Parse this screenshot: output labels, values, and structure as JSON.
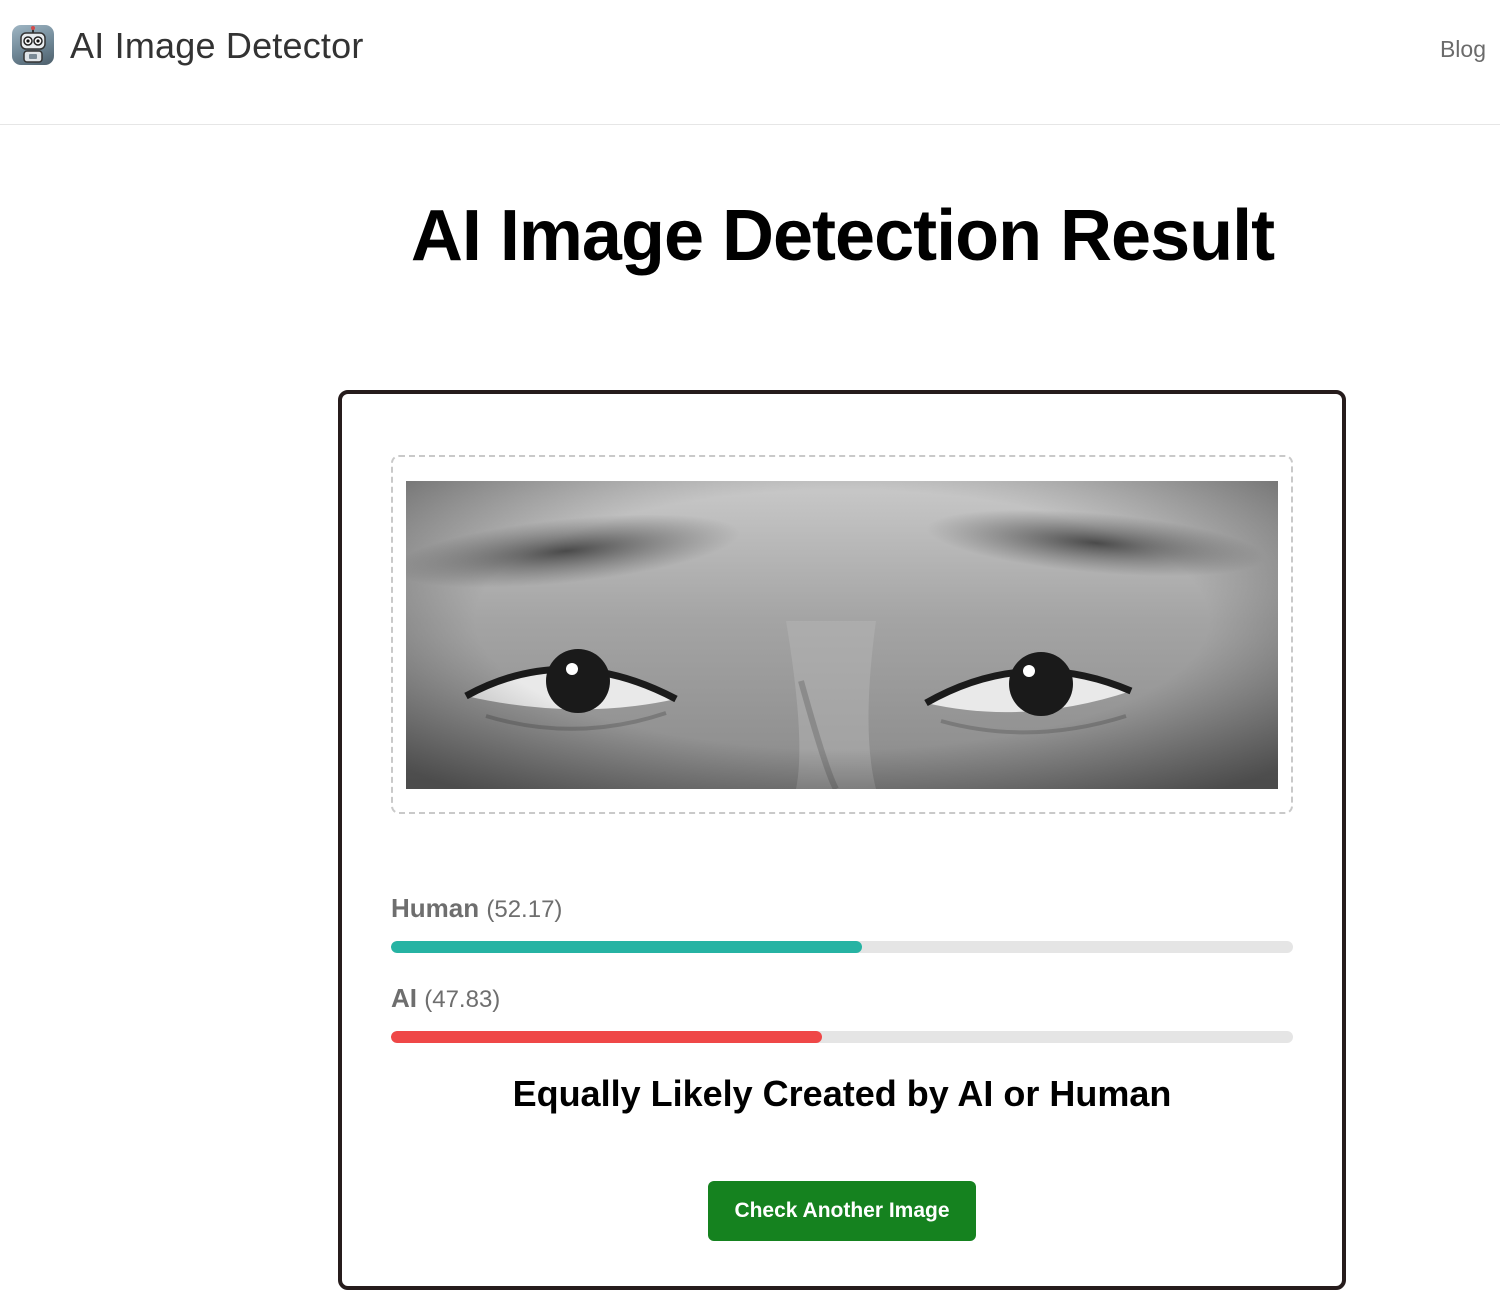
{
  "header": {
    "brand": "AI Image Detector",
    "logo_icon": "robot-icon",
    "nav": {
      "blog_label": "Blog"
    }
  },
  "main": {
    "title": "AI Image Detection Result",
    "preview_image": "grayscale close-up photo of a person's eyes",
    "results": [
      {
        "label": "Human",
        "score_text": "(52.17)",
        "score": 52.17,
        "color": "#26b3a3"
      },
      {
        "label": "AI",
        "score_text": "(47.83)",
        "score": 47.83,
        "color": "#ef4747"
      }
    ],
    "verdict": "Equally Likely Created by AI or Human",
    "action_button": "Check Another Image"
  },
  "colors": {
    "button_green": "#15821f",
    "track_gray": "#e5e5e5",
    "card_border": "#261c1c"
  }
}
